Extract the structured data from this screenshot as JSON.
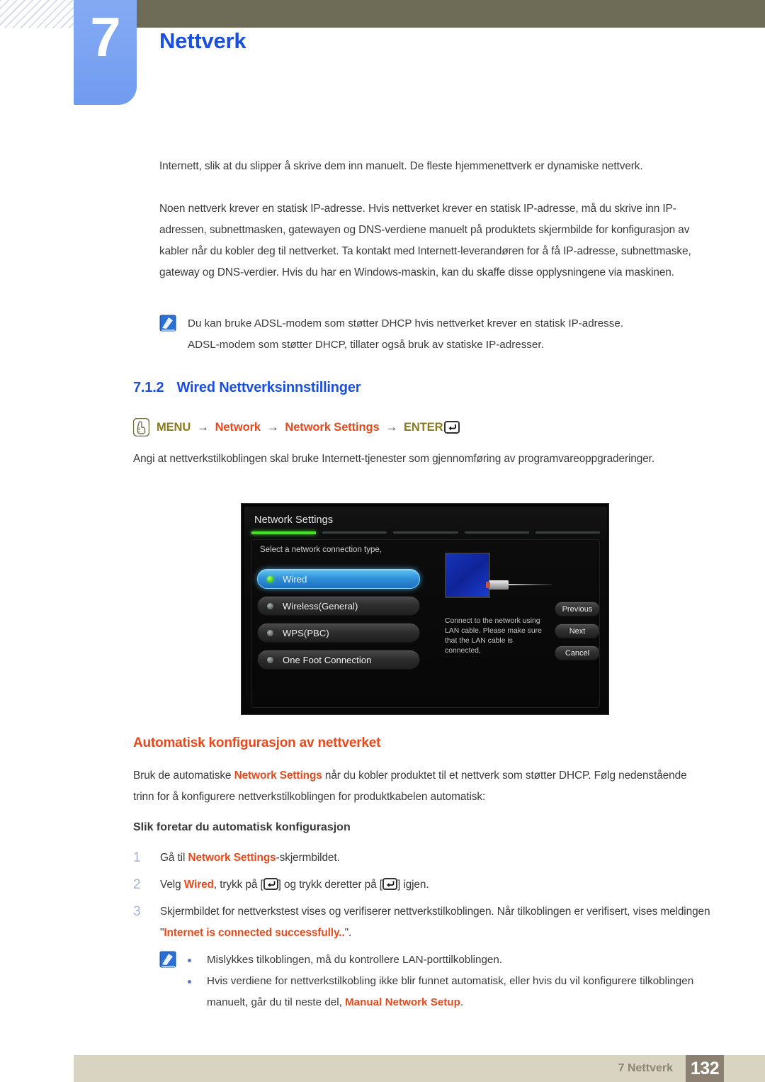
{
  "header": {
    "chapter_number": "7",
    "chapter_title": "Nettverk"
  },
  "body": {
    "para1": "Internett, slik at du slipper å skrive dem inn manuelt. De fleste hjemmenettverk er dynamiske nettverk.",
    "para2": "Noen nettverk krever en statisk IP-adresse. Hvis nettverket krever en statisk IP-adresse, må du skrive inn IP-adressen, subnettmasken, gatewayen og DNS-verdiene manuelt på produktets skjermbilde for konfigurasjon av kabler når du kobler deg til nettverket. Ta kontakt med Internett-leverandøren for å få IP-adresse, subnettmaske, gateway og DNS-verdier. Hvis du har en Windows-maskin, kan du skaffe disse opplysningene via maskinen.",
    "note1_line1": "Du kan bruke ADSL-modem som støtter DHCP hvis nettverket krever en statisk IP-adresse.",
    "note1_line2": "ADSL-modem som støtter DHCP, tillater også bruk av statiske IP-adresser.",
    "section_number": "7.1.2",
    "section_title": "Wired Nettverksinnstillinger",
    "menu_path": {
      "icon": "hand-press-icon",
      "item1": "MENU",
      "arrow": "→",
      "item2": "Network",
      "item3": "Network Settings",
      "item4": "ENTER",
      "enter_icon": "enter-key-icon"
    },
    "para3": "Angi at nettverkstilkoblingen skal bruke Internett-tjenester som gjennomføring av programvareoppgraderinger.",
    "heading_auto": "Automatisk konfigurasjon av nettverket",
    "para4_pre": "Bruk de automatiske ",
    "para4_link": "Network Settings",
    "para4_post": " når du kobler produktet til et nettverk som støtter DHCP. Følg nedenstående trinn for å konfigurere nettverkstilkoblingen for produktkabelen automatisk:",
    "heading_howto": "Slik foretar du automatisk konfigurasjon",
    "steps": [
      {
        "num": "1",
        "pre": "Gå til ",
        "link": "Network Settings",
        "post": "-skjermbildet."
      },
      {
        "num": "2",
        "pre": "Velg ",
        "link": "Wired",
        "mid1": ", trykk på [",
        "mid2": "] og trykk deretter på [",
        "post": "] igjen."
      },
      {
        "num": "3",
        "pre": "Skjermbildet for nettverkstest vises og verifiserer nettverkstilkoblingen. Når tilkoblingen er verifisert, vises meldingen \"",
        "link": "Internet is connected successfully..",
        "post": "\"."
      }
    ],
    "note2_bullet1": "Mislykkes tilkoblingen, må du kontrollere LAN-porttilkoblingen.",
    "note2_bullet2_pre": "Hvis verdiene for nettverkstilkobling ikke blir funnet automatisk, eller hvis du vil konfigurere tilkoblingen manuelt, går du til neste del, ",
    "note2_bullet2_link": "Manual Network Setup",
    "note2_bullet2_post": "."
  },
  "tv_screenshot": {
    "title": "Network Settings",
    "hint": "Select a network connection type,",
    "options": [
      {
        "label": "Wired",
        "selected": true
      },
      {
        "label": "Wireless(General)",
        "selected": false
      },
      {
        "label": "WPS(PBC)",
        "selected": false
      },
      {
        "label": "One Foot Connection",
        "selected": false
      }
    ],
    "description": "Connect to the network using LAN cable. Please make sure that the LAN cable is connected,",
    "buttons": [
      "Previous",
      "Next",
      "Cancel"
    ],
    "progress_segments": 5,
    "progress_active_index": 0
  },
  "footer": {
    "label": "7 Nettverk",
    "page_number": "132"
  },
  "colors": {
    "accent_blue": "#1a4fe0",
    "accent_orange": "#e8491c",
    "olive": "#6d6a55",
    "menu_olive": "#8a7b1f",
    "footer_beige": "#d9d4c1",
    "footer_pagebox": "#8c8072",
    "badge_blue": "#7ba3f2",
    "tv_green": "#46e02a"
  }
}
